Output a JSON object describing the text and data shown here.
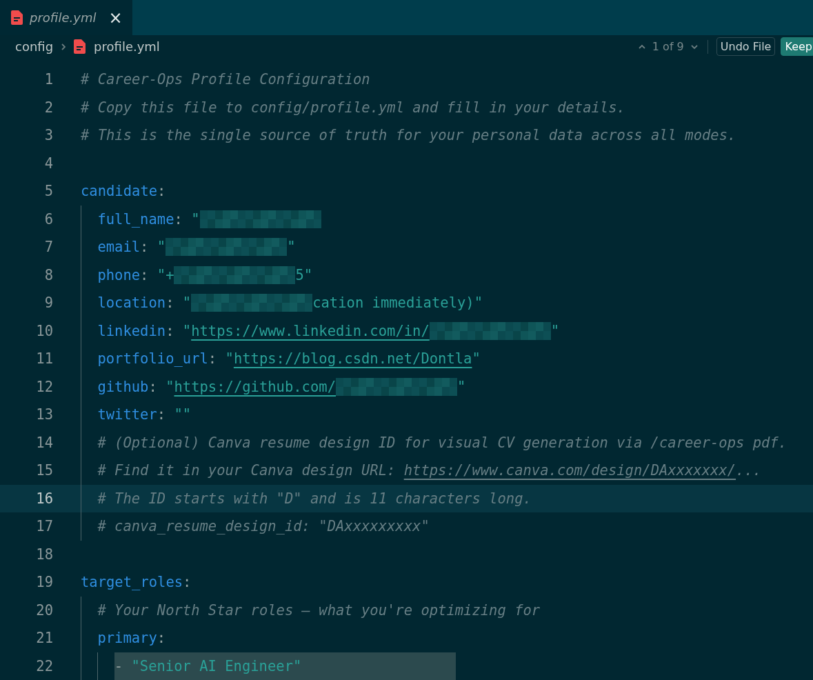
{
  "tabs": [
    {
      "label": "profile.yml",
      "selected": true,
      "preview": true,
      "close": "×"
    }
  ],
  "breadcrumb": {
    "items": [
      "config",
      "profile.yml"
    ]
  },
  "diff_nav": {
    "position": "1 of 9",
    "buttons": [
      {
        "label": "Undo File",
        "kind": "outline"
      },
      {
        "label": "Keep",
        "kind": "primary"
      }
    ]
  },
  "editor": {
    "lines": [
      {
        "number": "1",
        "current": false,
        "changed": false,
        "tokens": [
          {
            "kind": "comment",
            "text": "# Career-Ops Profile Configuration"
          }
        ]
      },
      {
        "number": "2",
        "current": false,
        "changed": false,
        "tokens": [
          {
            "kind": "comment",
            "text": "# Copy this file to config/profile.yml and fill in your details."
          }
        ]
      },
      {
        "number": "3",
        "current": false,
        "changed": false,
        "tokens": [
          {
            "kind": "comment",
            "text": "# This is the single source of truth for your personal data across all modes."
          }
        ]
      },
      {
        "number": "4",
        "current": false,
        "changed": false
      },
      {
        "number": "5",
        "current": false,
        "changed": false,
        "tokens": [
          {
            "kind": "key",
            "text": "candidate"
          },
          {
            "kind": "punct",
            "text": ":"
          }
        ],
        "children": [
          {
            "number": "6",
            "current": false,
            "changed": false,
            "tokens": [
              {
                "kind": "key",
                "text": "full_name"
              },
              {
                "kind": "punct",
                "text": ": "
              },
              {
                "kind": "string",
                "text": "\""
              },
              {
                "kind": "redacted"
              }
            ]
          },
          {
            "number": "7",
            "current": false,
            "changed": false,
            "tokens": [
              {
                "kind": "key",
                "text": "email"
              },
              {
                "kind": "punct",
                "text": ": "
              },
              {
                "kind": "string",
                "text": "\""
              },
              {
                "kind": "redacted"
              },
              {
                "kind": "string",
                "text": "\""
              }
            ]
          },
          {
            "number": "8",
            "current": false,
            "changed": false,
            "tokens": [
              {
                "kind": "key",
                "text": "phone"
              },
              {
                "kind": "punct",
                "text": ": "
              },
              {
                "kind": "string",
                "text": "\"+"
              },
              {
                "kind": "redacted"
              },
              {
                "kind": "string",
                "text": "5\""
              }
            ]
          },
          {
            "number": "9",
            "current": false,
            "changed": false,
            "tokens": [
              {
                "kind": "key",
                "text": "location"
              },
              {
                "kind": "punct",
                "text": ": "
              },
              {
                "kind": "string",
                "text": "\""
              },
              {
                "kind": "redacted"
              },
              {
                "kind": "string",
                "text": "cation immediately)\""
              }
            ]
          },
          {
            "number": "10",
            "current": false,
            "changed": false,
            "tokens": [
              {
                "kind": "key",
                "text": "linkedin"
              },
              {
                "kind": "punct",
                "text": ": "
              },
              {
                "kind": "string",
                "text": "\""
              },
              {
                "kind": "link",
                "text": "https://www.linkedin.com/in/"
              },
              {
                "kind": "redacted"
              },
              {
                "kind": "string",
                "text": "\""
              }
            ]
          },
          {
            "number": "11",
            "current": false,
            "changed": false,
            "tokens": [
              {
                "kind": "key",
                "text": "portfolio_url"
              },
              {
                "kind": "punct",
                "text": ": "
              },
              {
                "kind": "string",
                "text": "\""
              },
              {
                "kind": "link",
                "text": "https://blog.csdn.net/Dontla"
              },
              {
                "kind": "string",
                "text": "\""
              }
            ]
          },
          {
            "number": "12",
            "current": false,
            "changed": false,
            "tokens": [
              {
                "kind": "key",
                "text": "github"
              },
              {
                "kind": "punct",
                "text": ": "
              },
              {
                "kind": "string",
                "text": "\""
              },
              {
                "kind": "link",
                "text": "https://github.com/"
              },
              {
                "kind": "redacted"
              },
              {
                "kind": "string",
                "text": "\""
              }
            ]
          },
          {
            "number": "13",
            "current": false,
            "changed": false,
            "tokens": [
              {
                "kind": "key",
                "text": "twitter"
              },
              {
                "kind": "punct",
                "text": ": "
              },
              {
                "kind": "string",
                "text": "\"\""
              }
            ]
          },
          {
            "number": "14",
            "current": false,
            "changed": false,
            "tokens": [
              {
                "kind": "comment",
                "text": "# (Optional) Canva resume design ID for visual CV generation via /career-ops pdf."
              }
            ]
          },
          {
            "number": "15",
            "current": false,
            "changed": false,
            "tokens": [
              {
                "kind": "comment",
                "text": "# Find it in your Canva design URL: "
              },
              {
                "kind": "comment_link",
                "text": "https://www.canva.com/design/DAxxxxxxx/"
              },
              {
                "kind": "comment",
                "text": "..."
              }
            ]
          },
          {
            "number": "16",
            "current": true,
            "changed": false,
            "tokens": [
              {
                "kind": "comment",
                "text": "# The ID starts with \"D\" and is 11 characters long."
              }
            ]
          },
          {
            "number": "17",
            "current": false,
            "changed": false,
            "tokens": [
              {
                "kind": "comment",
                "text": "# canva_resume_design_id: \"DAxxxxxxxxx\""
              }
            ]
          }
        ]
      },
      {
        "number": "18",
        "current": false,
        "changed": false
      },
      {
        "number": "19",
        "current": false,
        "changed": false,
        "tokens": [
          {
            "kind": "key",
            "text": "target_roles"
          },
          {
            "kind": "punct",
            "text": ":"
          }
        ],
        "children": [
          {
            "number": "20",
            "current": false,
            "changed": false,
            "tokens": [
              {
                "kind": "comment",
                "text": "# Your North Star roles — what you're optimizing for"
              }
            ]
          },
          {
            "number": "21",
            "current": false,
            "changed": false,
            "tokens": [
              {
                "kind": "key",
                "text": "primary"
              },
              {
                "kind": "punct",
                "text": ":"
              }
            ],
            "children": [
              {
                "number": "22",
                "current": false,
                "changed": true,
                "tokens": [
                  {
                    "kind": "punct",
                    "text": "- "
                  },
                  {
                    "kind": "string",
                    "text": "\"Senior AI Engineer\""
                  }
                ]
              }
            ]
          }
        ]
      }
    ]
  }
}
